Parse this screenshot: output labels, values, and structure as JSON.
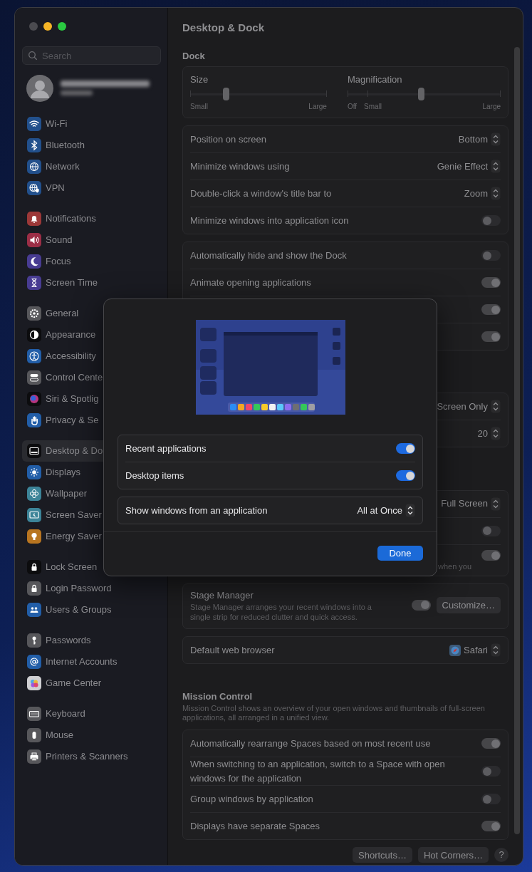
{
  "window": {
    "traffic_lights": [
      {
        "color": "#4b4b50"
      },
      {
        "color": "#f5b426"
      },
      {
        "color": "#2ac941"
      }
    ]
  },
  "sidebar": {
    "search": {
      "placeholder": "Search"
    },
    "groups": [
      {
        "items": [
          {
            "label": "Wi-Fi",
            "kind": "wifi",
            "color": "#22508c",
            "selected": false
          },
          {
            "label": "Bluetooth",
            "kind": "bluetooth",
            "color": "#22508c",
            "selected": false
          },
          {
            "label": "Network",
            "kind": "globe",
            "color": "#22508c",
            "selected": false
          },
          {
            "label": "VPN",
            "kind": "vpn",
            "color": "#22508c",
            "selected": false
          }
        ]
      },
      {
        "items": [
          {
            "label": "Notifications",
            "kind": "bell",
            "color": "#9c3838",
            "selected": false
          },
          {
            "label": "Sound",
            "kind": "speaker",
            "color": "#9c2e46",
            "selected": false
          },
          {
            "label": "Focus",
            "kind": "moon",
            "color": "#483c92",
            "selected": false
          },
          {
            "label": "Screen Time",
            "kind": "hourglass",
            "color": "#483c92",
            "selected": false
          }
        ]
      },
      {
        "items": [
          {
            "label": "General",
            "kind": "gear",
            "color": "#57575b",
            "selected": false
          },
          {
            "label": "Appearance",
            "kind": "contrast",
            "color": "#0c0c0e",
            "selected": false
          },
          {
            "label": "Accessibility",
            "kind": "person",
            "color": "#225ea8",
            "selected": false
          },
          {
            "label": "Control Cente",
            "kind": "switches",
            "color": "#57575b",
            "selected": false
          },
          {
            "label": "Siri & Spotlig",
            "kind": "orb",
            "color": "#0c0c0e",
            "selected": false
          },
          {
            "label": "Privacy & Se",
            "kind": "hand",
            "color": "#225ea8",
            "selected": false
          }
        ]
      },
      {
        "items": [
          {
            "label": "Desktop & Do",
            "kind": "dock",
            "color": "#0c0c0e",
            "selected": true
          },
          {
            "label": "Displays",
            "kind": "sun",
            "color": "#225ea8",
            "selected": false
          },
          {
            "label": "Wallpaper",
            "kind": "flower",
            "color": "#3c8498",
            "selected": false
          },
          {
            "label": "Screen Saver",
            "kind": "screensaver",
            "color": "#3c8498",
            "selected": false
          },
          {
            "label": "Energy Saver",
            "kind": "bulb",
            "color": "#b87520",
            "selected": false
          }
        ]
      },
      {
        "items": [
          {
            "label": "Lock Screen",
            "kind": "lock",
            "color": "#0c0c0e",
            "selected": false
          },
          {
            "label": "Login Password",
            "kind": "lock",
            "color": "#57575b",
            "selected": false
          },
          {
            "label": "Users & Groups",
            "kind": "people",
            "color": "#225ea8",
            "selected": false
          }
        ]
      },
      {
        "items": [
          {
            "label": "Passwords",
            "kind": "key",
            "color": "#57575b",
            "selected": false
          },
          {
            "label": "Internet Accounts",
            "kind": "at",
            "color": "#225ea8",
            "selected": false
          },
          {
            "label": "Game Center",
            "kind": "bubbles",
            "color": "#cfcfd2",
            "selected": false
          }
        ]
      },
      {
        "items": [
          {
            "label": "Keyboard",
            "kind": "keyboard",
            "color": "#57575b",
            "selected": false
          },
          {
            "label": "Mouse",
            "kind": "mouse",
            "color": "#57575b",
            "selected": false
          },
          {
            "label": "Printers & Scanners",
            "kind": "printer",
            "color": "#57575b",
            "selected": false
          }
        ]
      }
    ]
  },
  "content": {
    "title": "Desktop & Dock",
    "sections": [
      {
        "heading": "Dock",
        "groups": [
          {
            "kind": "sliders",
            "sliders": [
              {
                "label": "Size",
                "level": 0.26,
                "ticks": [
                  "Small",
                  "Large"
                ]
              },
              {
                "label": "Magnification",
                "level": 0.48,
                "ticks": [
                  "Off",
                  "Small",
                  "Large"
                ]
              }
            ]
          },
          {
            "kind": "rows",
            "rows": [
              {
                "kind": "popup",
                "label": "Position on screen",
                "value": "Bottom"
              },
              {
                "kind": "popup",
                "label": "Minimize windows using",
                "value": "Genie Effect"
              },
              {
                "kind": "popup",
                "label": "Double-click a window's title bar to",
                "value": "Zoom"
              },
              {
                "kind": "toggle",
                "label": "Minimize windows into application icon",
                "on": false
              }
            ]
          },
          {
            "kind": "rows",
            "rows": [
              {
                "kind": "toggle",
                "label": "Automatically hide and show the Dock",
                "on": false
              },
              {
                "kind": "toggle",
                "label": "Animate opening applications",
                "on": true
              },
              {
                "kind": "toggle",
                "on": true
              },
              {
                "kind": "toggle",
                "on": true
              }
            ]
          }
        ]
      },
      {
        "groups": [
          {
            "kind": "rows",
            "rows": [
              {
                "kind": "popup",
                "value": "Screen Only"
              },
              {
                "kind": "popup",
                "value": "20"
              }
            ]
          }
        ]
      },
      {
        "groups": [
          {
            "kind": "rows",
            "rows": [
              {
                "kind": "popup",
                "value": "Full Screen"
              },
              {
                "kind": "toggle",
                "on": false
              },
              {
                "kind": "toggle",
                "on": true,
                "description": "when you"
              }
            ]
          },
          {
            "kind": "rows",
            "rows": [
              {
                "kind": "stage",
                "label": "Stage Manager",
                "description": "Stage Manager arranges your recent windows into a single strip for reduced clutter and quick access.",
                "on": true,
                "button": "Customize…"
              }
            ]
          },
          {
            "kind": "rows",
            "rows": [
              {
                "kind": "popup",
                "label": "Default web browser",
                "value": "Safari",
                "app_icon": true
              }
            ]
          }
        ]
      },
      {
        "heading": "Mission Control",
        "description": "Mission Control shows an overview of your open windows and thumbnails of full-screen applications, all arranged in a unified view.",
        "groups": [
          {
            "kind": "rows",
            "rows": [
              {
                "kind": "toggle",
                "label": "Automatically rearrange Spaces based on most recent use",
                "on": true
              },
              {
                "kind": "toggle",
                "label": "When switching to an application, switch to a Space with open windows for the application",
                "on": false
              },
              {
                "kind": "toggle",
                "label": "Group windows by application",
                "on": false
              },
              {
                "kind": "toggle",
                "label": "Displays have separate Spaces",
                "on": true
              }
            ]
          }
        ]
      }
    ],
    "footer_buttons": [
      {
        "kind": "text",
        "label": "Shortcuts…"
      },
      {
        "kind": "text",
        "label": "Hot Corners…"
      },
      {
        "kind": "help",
        "label": "?"
      }
    ]
  },
  "sheet": {
    "groups": [
      {
        "rows": [
          {
            "kind": "toggle",
            "label": "Recent applications",
            "on": true
          },
          {
            "kind": "toggle",
            "label": "Desktop items",
            "on": true
          }
        ]
      },
      {
        "rows": [
          {
            "kind": "popup",
            "label": "Show windows from an application",
            "value": "All at Once"
          }
        ]
      }
    ],
    "button": "Done"
  }
}
